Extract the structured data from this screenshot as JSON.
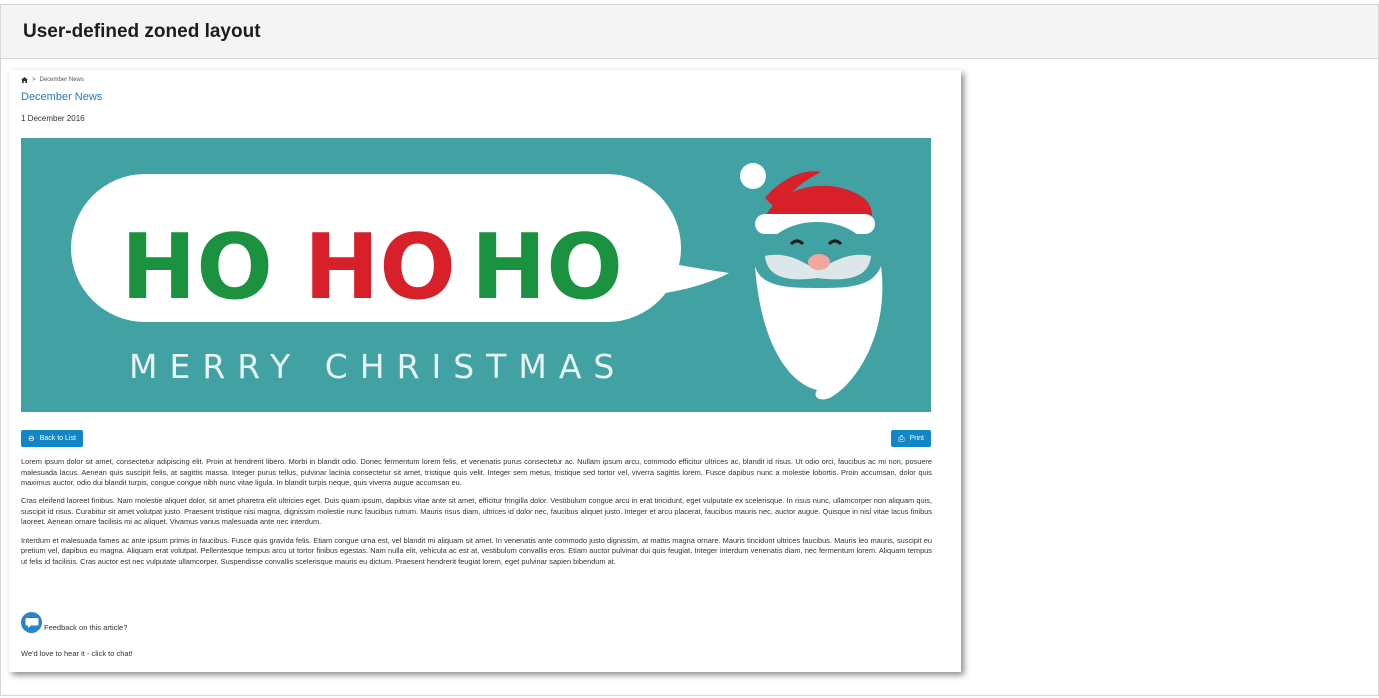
{
  "frame": {
    "title": "User-defined zoned layout"
  },
  "breadcrumb": {
    "home_icon": "home-icon",
    "separator": ">",
    "current": "December News"
  },
  "article": {
    "title": "December News",
    "date": "1 December 2016",
    "banner": {
      "bubble_words": [
        "HO",
        "HO",
        "HO"
      ],
      "subtitle": "MERRY CHRISTMAS",
      "colors": {
        "background": "#42a2a3",
        "green": "#1a9240",
        "red": "#d7202a",
        "white": "#ffffff"
      }
    },
    "paragraphs": [
      "Lorem ipsum dolor sit amet, consectetur adipiscing elit. Proin at hendrerit libero. Morbi in blandit odio. Donec fermentum lorem felis, et venenatis purus consectetur ac. Nullam ipsum arcu, commodo efficitur ultrices ac, blandit id risus. Ut odio orci, faucibus ac mi non, posuere malesuada lacus. Aenean quis suscipit felis, at sagittis massa. Integer purus tellus, pulvinar lacinia consectetur sit amet, tristique quis velit. Integer sem metus, tristique sed tortor vel, viverra sagittis lorem. Fusce dapibus nunc a molestie lobortis. Proin accumsan, dolor quis maximus auctor, odio dui blandit turpis, congue congue nibh nunc vitae ligula. In blandit turpis neque, quis viverra augue accumsan eu.",
      "Cras eleifend laoreet finibus. Nam molestie aliquet dolor, sit amet pharetra elit ultricies eget. Duis quam ipsum, dapibus vitae ante sit amet, efficitur fringilla dolor. Vestibulum congue arcu in erat tincidunt, eget vulputate ex scelerisque. In risus nunc, ullamcorper non aliquam quis, suscipit id risus. Curabitur sit amet volutpat justo. Praesent tristique nisi magna, dignissim molestie nunc faucibus rutrum. Mauris risus diam, ultrices id dolor nec, faucibus aliquet justo. Integer et arcu placerat, faucibus mauris nec, auctor augue. Quisque in nisl vitae lacus finibus laoreet. Aenean ornare facilisis mi ac aliquet. Vivamus varius malesuada ante nec interdum.",
      "Interdum et malesuada fames ac ante ipsum primis in faucibus. Fusce quis gravida felis. Etiam congue urna est, vel blandit mi aliquam sit amet. In venenatis ante commodo justo dignissim, at mattis magna ornare. Mauris tincidunt ultrices faucibus. Mauris leo mauris, suscipit eu pretium vel, dapibus eu magna. Aliquam erat volutpat. Pellentesque tempus arcu ut tortor finibus egestas. Nam nulla elit, vehicula ac est at, vestibulum convallis eros. Etiam auctor pulvinar dui quis feugiat. Integer interdum venenatis diam, nec fermentum lorem. Aliquam tempus ut felis id facilisis. Cras auctor est nec vulputate ullamcorper. Suspendisse convallis scelerisque mauris eu dictum. Praesent hendrerit feugiat lorem, eget pulvinar sapien bibendum at."
    ]
  },
  "buttons": {
    "back": {
      "label": "Back to List",
      "icon": "circle-arrow-left-icon"
    },
    "print": {
      "label": "Print",
      "icon": "printer-icon"
    },
    "color": "#1286c7"
  },
  "feedback": {
    "icon": "chat-bubble-icon",
    "label": "Feedback on this article?",
    "chat_link": "We'd love to hear it - click to chat!"
  }
}
